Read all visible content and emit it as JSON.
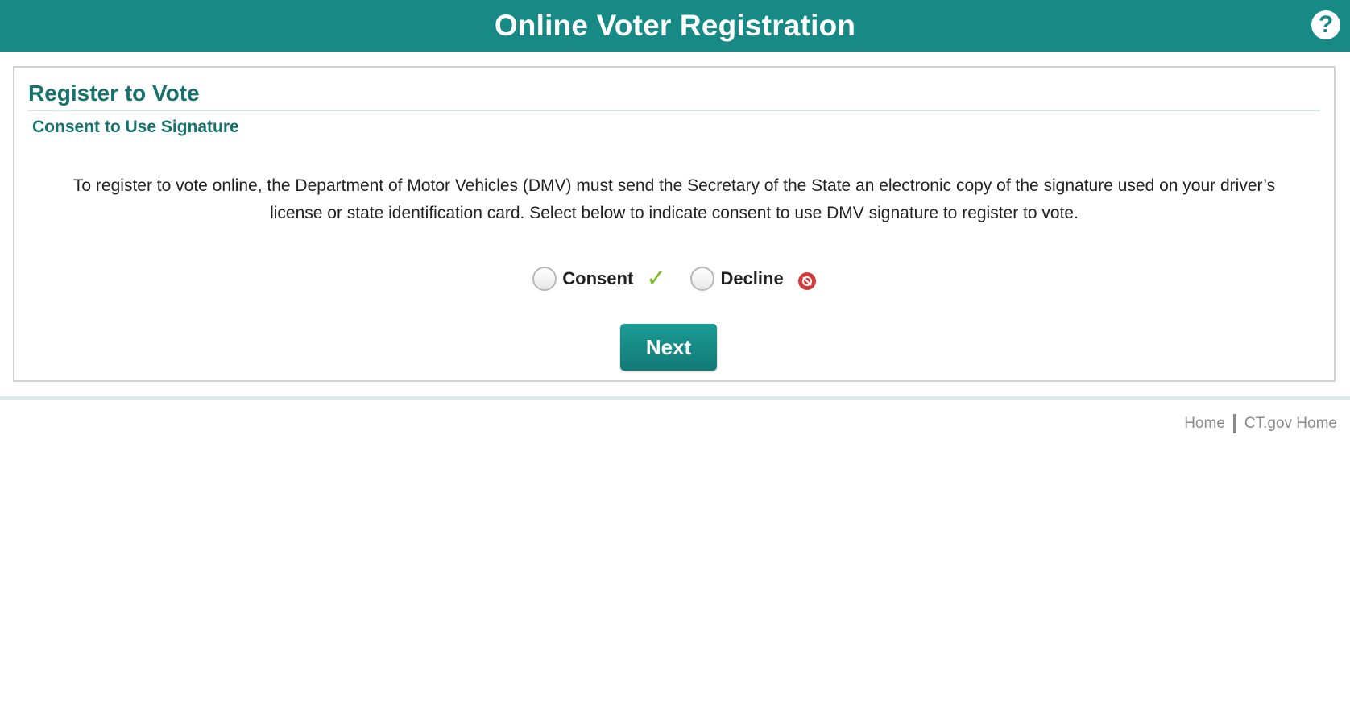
{
  "header": {
    "title": "Online Voter Registration",
    "help_icon": "?"
  },
  "panel": {
    "title": "Register to Vote",
    "subtitle": "Consent to Use Signature",
    "body_text": "To register to vote online, the Department of Motor Vehicles (DMV) must send the Secretary of the State an electronic copy of the signature used on your driver’s license or state identification card. Select below to indicate consent to use DMV signature to register to vote.",
    "options": [
      {
        "label": "Consent",
        "icon": "check-icon",
        "selected": false
      },
      {
        "label": "Decline",
        "icon": "no-icon",
        "selected": false
      }
    ],
    "next_label": "Next"
  },
  "footer": {
    "links": [
      "Home",
      "CT.gov Home"
    ]
  },
  "colors": {
    "brand": "#178a85",
    "heading": "#17716d",
    "consent_icon": "#7cbf25",
    "decline_icon": "#d23a3a"
  }
}
